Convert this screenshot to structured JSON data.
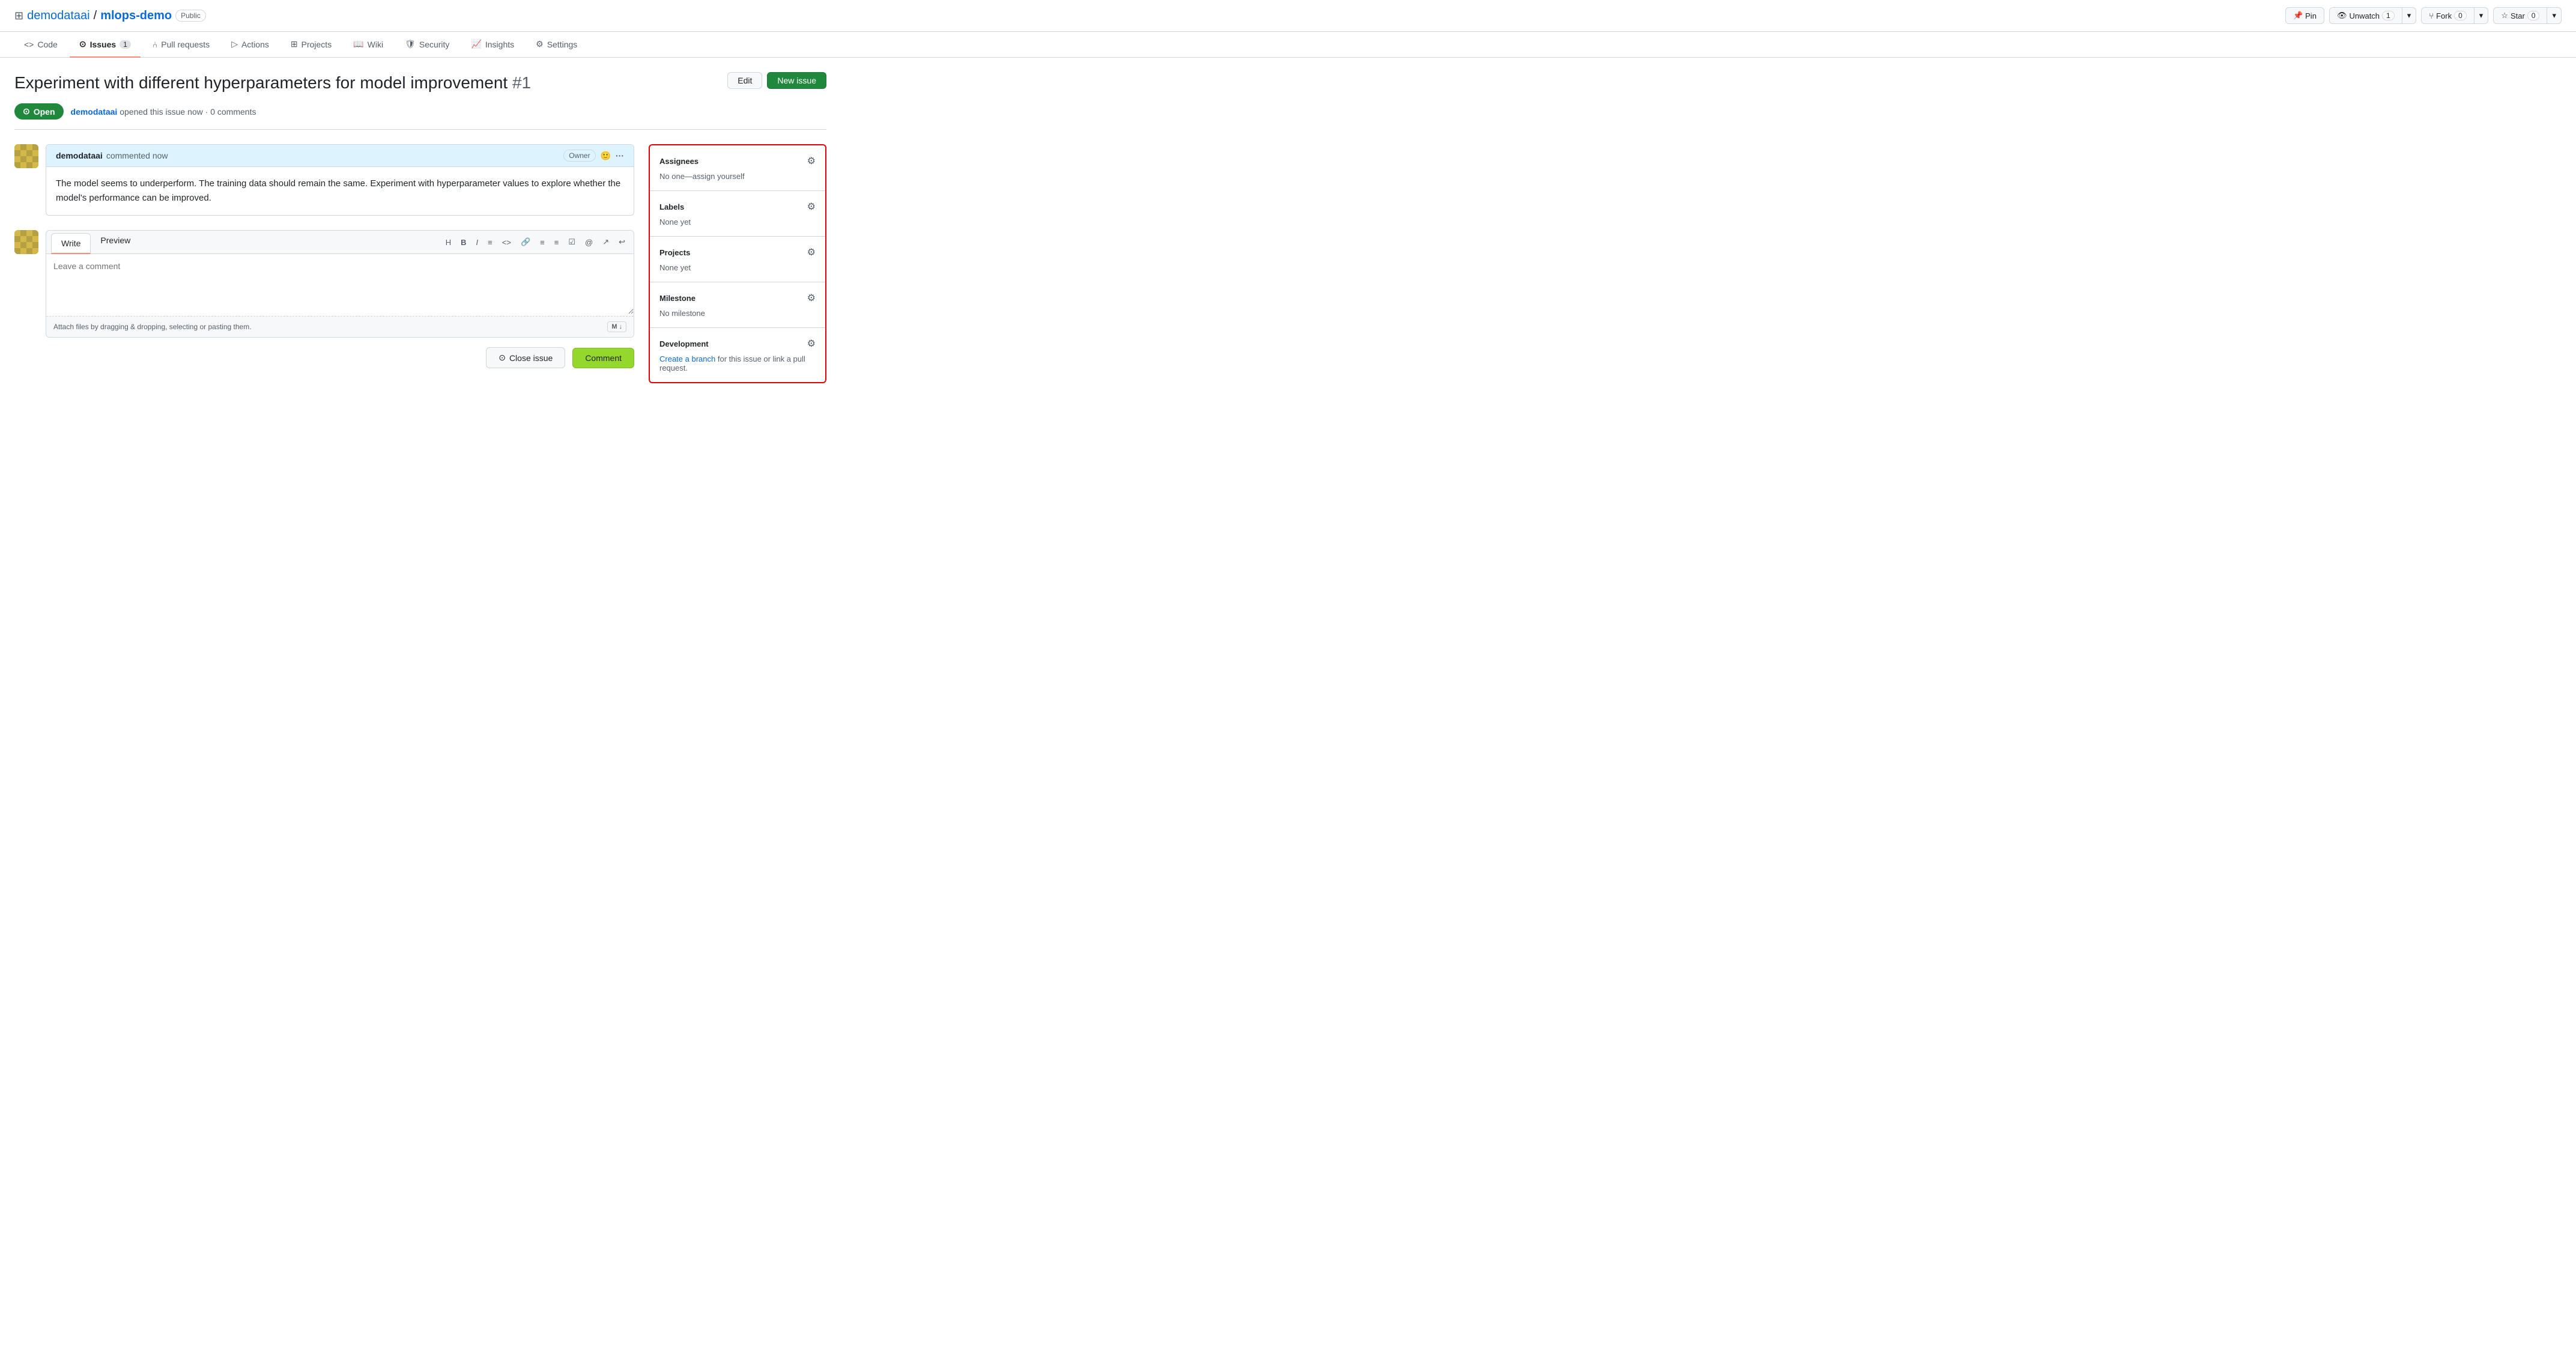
{
  "repo": {
    "owner": "demodataai",
    "name": "mlops-demo",
    "visibility": "Public"
  },
  "top_actions": {
    "pin_label": "Pin",
    "unwatch_label": "Unwatch",
    "unwatch_count": "1",
    "fork_label": "Fork",
    "fork_count": "0",
    "star_label": "Star",
    "star_count": "0"
  },
  "nav": {
    "tabs": [
      {
        "id": "code",
        "label": "Code",
        "badge": null,
        "active": false
      },
      {
        "id": "issues",
        "label": "Issues",
        "badge": "1",
        "active": true
      },
      {
        "id": "pull-requests",
        "label": "Pull requests",
        "badge": null,
        "active": false
      },
      {
        "id": "actions",
        "label": "Actions",
        "badge": null,
        "active": false
      },
      {
        "id": "projects",
        "label": "Projects",
        "badge": null,
        "active": false
      },
      {
        "id": "wiki",
        "label": "Wiki",
        "badge": null,
        "active": false
      },
      {
        "id": "security",
        "label": "Security",
        "badge": null,
        "active": false
      },
      {
        "id": "insights",
        "label": "Insights",
        "badge": null,
        "active": false
      },
      {
        "id": "settings",
        "label": "Settings",
        "badge": null,
        "active": false
      }
    ]
  },
  "issue": {
    "title": "Experiment with different hyperparameters for model improvement",
    "number": "#1",
    "status": "Open",
    "author": "demodataai",
    "time": "opened this issue now",
    "comments_count": "0 comments"
  },
  "header_actions": {
    "edit_label": "Edit",
    "new_issue_label": "New issue"
  },
  "comment": {
    "author": "demodataai",
    "time": "commented now",
    "role": "Owner",
    "body": "The model seems to underperform. The training data should remain the same. Experiment with hyperparameter values to explore whether the model's performance can be improved."
  },
  "editor": {
    "write_tab": "Write",
    "preview_tab": "Preview",
    "placeholder": "Leave a comment",
    "attach_text": "Attach files by dragging & dropping, selecting or pasting them."
  },
  "bottom_actions": {
    "close_issue_label": "Close issue",
    "comment_label": "Comment"
  },
  "sidebar": {
    "assignees": {
      "title": "Assignees",
      "value": "No one—assign yourself"
    },
    "labels": {
      "title": "Labels",
      "value": "None yet"
    },
    "projects": {
      "title": "Projects",
      "value": "None yet"
    },
    "milestone": {
      "title": "Milestone",
      "value": "No milestone"
    },
    "development": {
      "title": "Development",
      "link_text": "Create a branch",
      "value_suffix": " for this issue or link a pull request."
    }
  }
}
